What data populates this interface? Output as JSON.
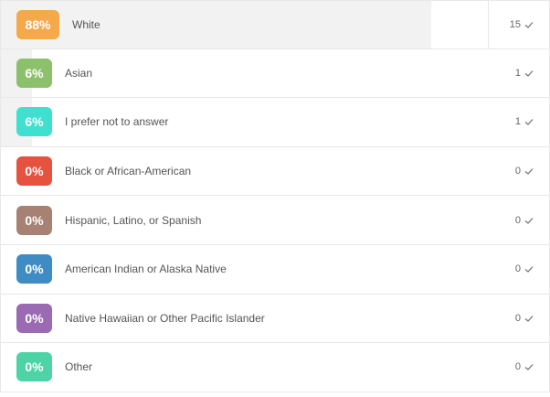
{
  "results": {
    "rows": [
      {
        "percent": 88,
        "percent_label": "88%",
        "label": "White",
        "count": "15",
        "color": "#f5a94b"
      },
      {
        "percent": 6,
        "percent_label": "6%",
        "label": "Asian",
        "count": "1",
        "color": "#8dc06b"
      },
      {
        "percent": 6,
        "percent_label": "6%",
        "label": "I prefer not to answer",
        "count": "1",
        "color": "#3fe0d0"
      },
      {
        "percent": 0,
        "percent_label": "0%",
        "label": "Black or African-American",
        "count": "0",
        "color": "#e55340"
      },
      {
        "percent": 0,
        "percent_label": "0%",
        "label": "Hispanic, Latino, or Spanish",
        "count": "0",
        "color": "#a78274"
      },
      {
        "percent": 0,
        "percent_label": "0%",
        "label": "American Indian or Alaska Native",
        "count": "0",
        "color": "#3f8cc4"
      },
      {
        "percent": 0,
        "percent_label": "0%",
        "label": "Native Hawaiian or Other Pacific Islander",
        "count": "0",
        "color": "#9a6ab2"
      },
      {
        "percent": 0,
        "percent_label": "0%",
        "label": "Other",
        "count": "0",
        "color": "#4dd3a6"
      }
    ],
    "check_icon": "check-icon"
  }
}
